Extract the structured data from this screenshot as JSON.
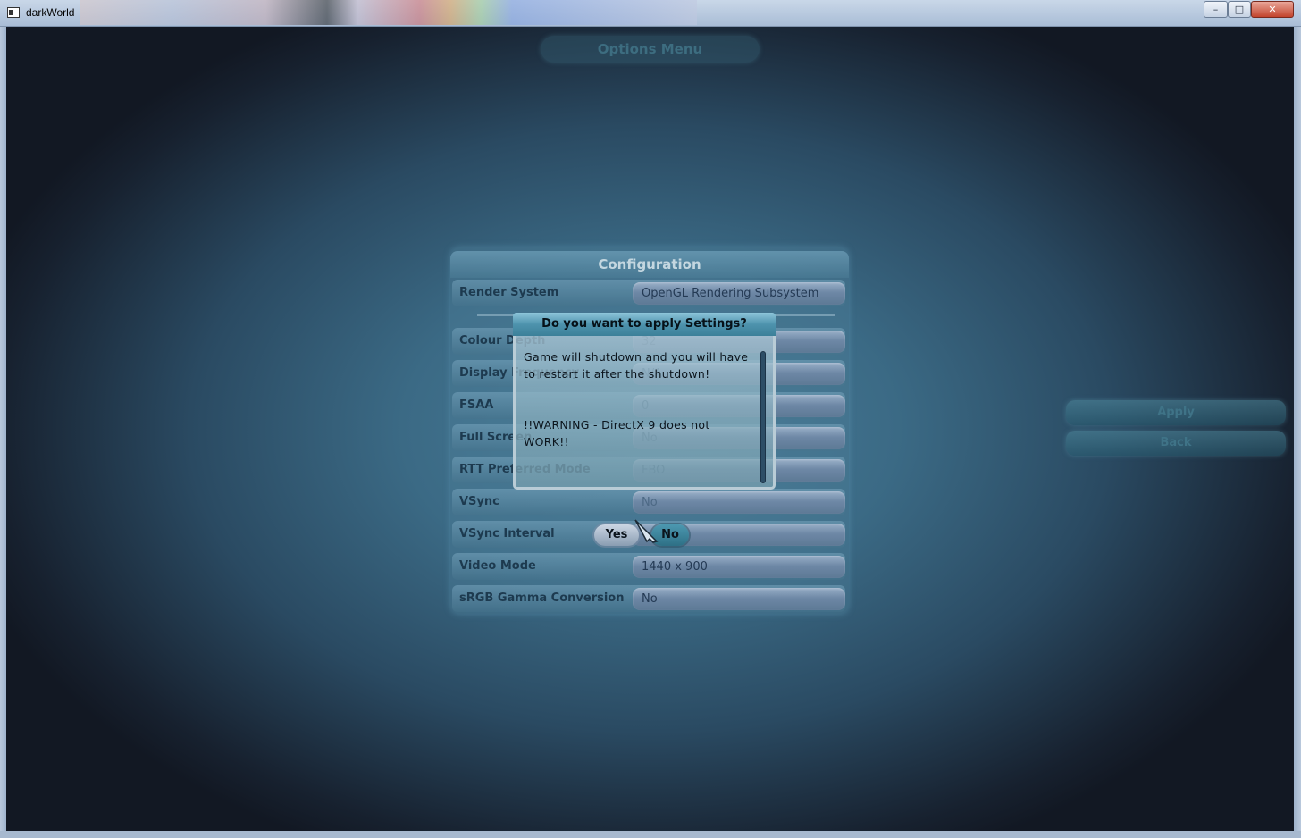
{
  "window": {
    "title": "darkWorld",
    "min_icon": "minimize-icon",
    "max_icon": "maximize-icon",
    "close_icon": "close-icon",
    "close_glyph": "✕",
    "min_glyph": "–",
    "max_glyph": "□"
  },
  "options_menu": {
    "title": "Options Menu"
  },
  "config": {
    "title": "Configuration",
    "rows": [
      {
        "label": "Render System",
        "value": "OpenGL Rendering Subsystem"
      },
      {
        "label": "Colour Depth",
        "value": "32"
      },
      {
        "label": "Display Frequency",
        "value": "N/A"
      },
      {
        "label": "FSAA",
        "value": "0"
      },
      {
        "label": "Full Screen",
        "value": "No"
      },
      {
        "label": "RTT Preferred Mode",
        "value": "FBO"
      },
      {
        "label": "VSync",
        "value": "No"
      },
      {
        "label": "VSync Interval",
        "value": ""
      },
      {
        "label": "Video Mode",
        "value": "1440 x 900"
      },
      {
        "label": "sRGB Gamma Conversion",
        "value": "No"
      }
    ]
  },
  "side_buttons": {
    "apply": "Apply",
    "back": "Back"
  },
  "dialog": {
    "title": "Do you want to apply Settings?",
    "message": "Game will shutdown and you will have to restart it after the shutdown!",
    "warning": "!!WARNING - DirectX 9 does not WORK!!",
    "yes": "Yes",
    "no": "No"
  }
}
